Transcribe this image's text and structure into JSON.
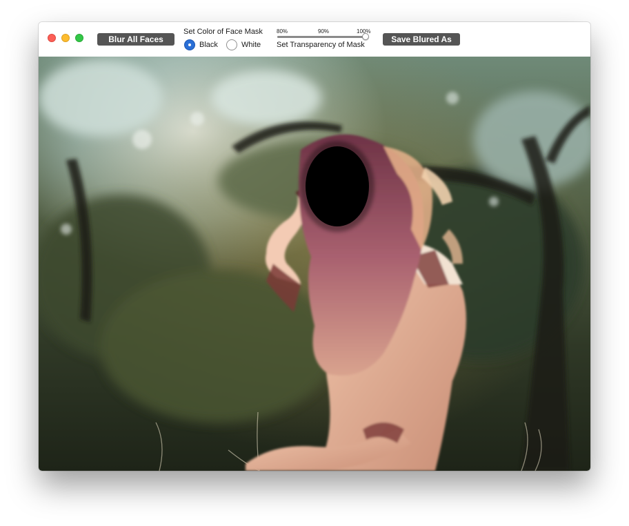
{
  "toolbar": {
    "blur_button_label": "Blur All Faces",
    "color_label": "Set Color of Face Mask",
    "color_options": [
      "Black",
      "White"
    ],
    "selected_color": "Black",
    "transparency_label": "Set Transparency of Mask",
    "transparency_ticks": [
      "80%",
      "90%",
      "100%"
    ],
    "transparency_percent": 100,
    "save_button_label": "Save Blured As"
  },
  "colors": {
    "button_bg": "#555555",
    "radio_selected": "#2a6fd6",
    "face_mask": "#000000"
  },
  "icons": {
    "close": "red-circle",
    "minimize": "yellow-circle",
    "maximize": "green-circle"
  }
}
